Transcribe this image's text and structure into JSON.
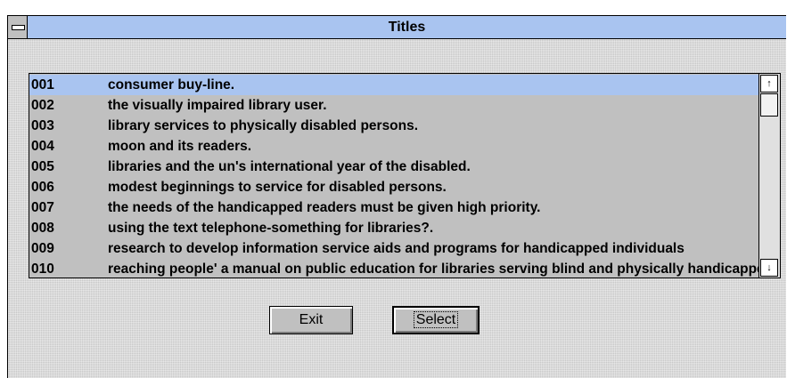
{
  "window": {
    "title": "Titles"
  },
  "list": {
    "rows": [
      {
        "num": "001",
        "title": "consumer buy-line."
      },
      {
        "num": "002",
        "title": "the visually impaired library user."
      },
      {
        "num": "003",
        "title": "library services to physically disabled persons."
      },
      {
        "num": "004",
        "title": "moon and its readers."
      },
      {
        "num": "005",
        "title": "libraries and the un's international year of the disabled."
      },
      {
        "num": "006",
        "title": "modest beginnings to service for disabled persons."
      },
      {
        "num": "007",
        "title": "the needs of the handicapped readers must be given high priority."
      },
      {
        "num": "008",
        "title": "using the text telephone-something for libraries?."
      },
      {
        "num": "009",
        "title": "research to develop information service aids and programs for handicapped  individuals"
      },
      {
        "num": "010",
        "title": "reaching people' a manual on public education for libraries serving blind and  physically handicapped"
      }
    ],
    "selected_index": 0
  },
  "scroll": {
    "up_glyph": "↑",
    "down_glyph": "↓"
  },
  "buttons": {
    "exit_label": "Exit",
    "select_label": "Select"
  },
  "colors": {
    "selection": "#a9c4f0",
    "titlebar": "#a9c4f0",
    "face": "#c0c0c0"
  }
}
